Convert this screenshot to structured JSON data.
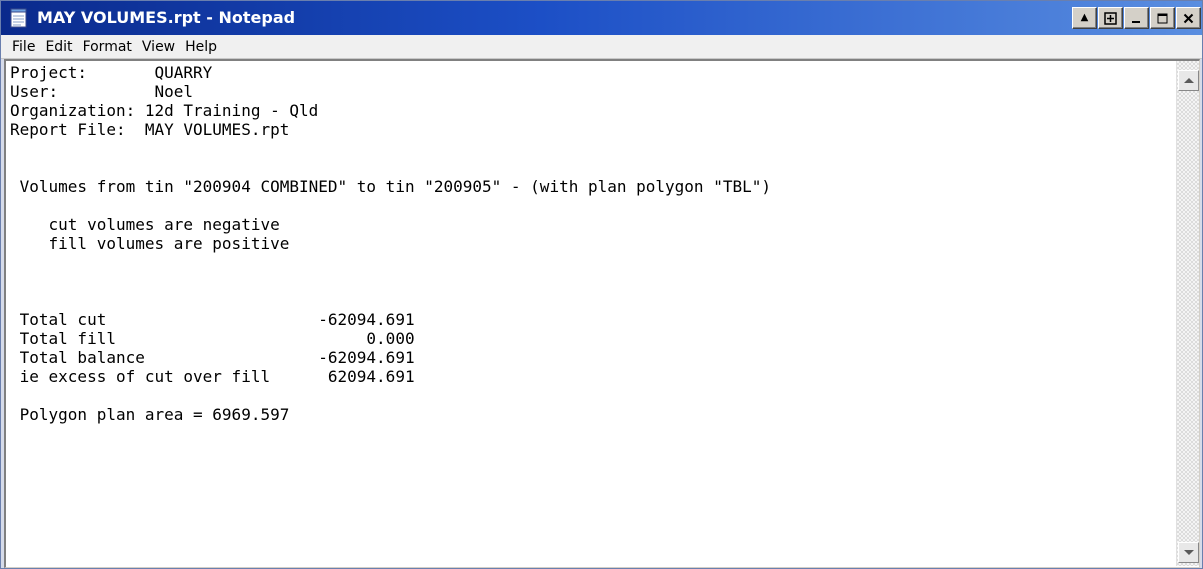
{
  "window": {
    "title": "MAY VOLUMES.rpt - Notepad",
    "title_gradient": [
      "#0a2a8c",
      "#1c4fc6",
      "#5a8ee0"
    ]
  },
  "title_controls": {
    "restore_up_glyph": "▲",
    "restore_bar_glyph": "⍈",
    "minimize_glyph": "_",
    "maximize_glyph": "□",
    "close_glyph": "✕"
  },
  "menu": {
    "items": [
      "File",
      "Edit",
      "Format",
      "View",
      "Help"
    ]
  },
  "document": {
    "content": "Project:       QUARRY\nUser:          Noel\nOrganization: 12d Training - Qld\nReport File:  MAY VOLUMES.rpt\n\n\n Volumes from tin \"200904 COMBINED\" to tin \"200905\" - (with plan polygon \"TBL\")\n\n    cut volumes are negative\n    fill volumes are positive\n\n\n\n Total cut                      -62094.691\n Total fill                          0.000\n Total balance                  -62094.691\n ie excess of cut over fill      62094.691\n\n Polygon plan area = 6969.597\n"
  },
  "icons": {
    "app": "notepad-icon",
    "scroll_up": "arrow-up-icon",
    "scroll_down": "arrow-down-icon"
  }
}
